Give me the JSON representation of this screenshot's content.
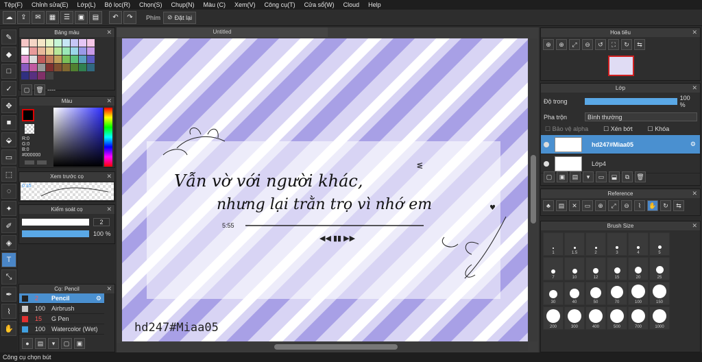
{
  "menu": [
    "Tệp(F)",
    "Chỉnh sửa(E)",
    "Lớp(L)",
    "Bộ lọc(R)",
    "Chọn(S)",
    "Chụp(N)",
    "Màu (C)",
    "Xem(V)",
    "Công cụ(T)",
    "Cửa sổ(W)",
    "Cloud",
    "Help"
  ],
  "toolbar": {
    "phim_label": "Phím",
    "reset_label": "Đặt lại"
  },
  "palette": {
    "title": "Bảng màu",
    "footer": "----",
    "colors": [
      "#f5c6c6",
      "#f5d6c6",
      "#f5e6c6",
      "#e6f5c6",
      "#c6f5d6",
      "#c6e6f5",
      "#c6c6f5",
      "#e6c6f5",
      "#f5c6e6",
      "#ffffff",
      "#e89a9a",
      "#e8b89a",
      "#e8d69a",
      "#b8e89a",
      "#9ae8b8",
      "#9ad6e8",
      "#9a9ae8",
      "#c89ae8",
      "#e89ad6",
      "#dddddd",
      "#c05a5a",
      "#c07a5a",
      "#c0a05a",
      "#7ac05a",
      "#5ac07a",
      "#5aa0c0",
      "#5a5ac0",
      "#8a5ac0",
      "#c05aa0",
      "#999999",
      "#803030",
      "#805030",
      "#806830",
      "#508030",
      "#308050",
      "#306880",
      "#303080",
      "#583080",
      "#803068",
      "#444444"
    ]
  },
  "color_panel": {
    "title": "Màu",
    "r": "R:0",
    "g": "G:0",
    "b": "B:0",
    "hex": "#000000"
  },
  "preview_panel": {
    "title": "Xem trước cọ",
    "size": "0.15"
  },
  "brush_control": {
    "title": "Kiểm soát cọ",
    "size_value": "2",
    "opacity_value": "100 %"
  },
  "brush_list": {
    "title": "Cọ: Pencil",
    "items": [
      {
        "size": "2",
        "name": "Pencil",
        "color": "#222222"
      },
      {
        "size": "100",
        "name": "Airbrush",
        "color": "#cccccc"
      },
      {
        "size": "15",
        "name": "G Pen",
        "color": "#e03030"
      },
      {
        "size": "100",
        "name": "Watercolor (Wet)",
        "color": "#40a0e0"
      }
    ]
  },
  "canvas": {
    "tab_title": "Untitled",
    "line1": "Vẫn vờ với người khác,",
    "line2": "nhưng lại trằn trọ vì nhớ em",
    "time": "5:55",
    "watermark": "hd247#Miaa05"
  },
  "navigator": {
    "title": "Hoa tiêu"
  },
  "layers": {
    "title": "Lớp",
    "opacity_label": "Độ trong",
    "opacity_value": "100 %",
    "blend_label": "Pha trộn",
    "blend_value": "Bình thường",
    "protect_alpha": "Bảo vệ alpha",
    "clipping": "Xén bớt",
    "lock": "Khóa",
    "items": [
      {
        "name": "hd247#Miaa05"
      },
      {
        "name": "Lớp4"
      }
    ]
  },
  "reference": {
    "title": "Reference"
  },
  "brush_size": {
    "title": "Brush Size",
    "sizes": [
      "1",
      "1.5",
      "2",
      "3",
      "4",
      "5",
      "7",
      "10",
      "12",
      "15",
      "20",
      "25",
      "30",
      "40",
      "50",
      "70",
      "100",
      "150",
      "200",
      "300",
      "400",
      "500",
      "700",
      "1000"
    ]
  },
  "status": "Công cụ chọn bút"
}
